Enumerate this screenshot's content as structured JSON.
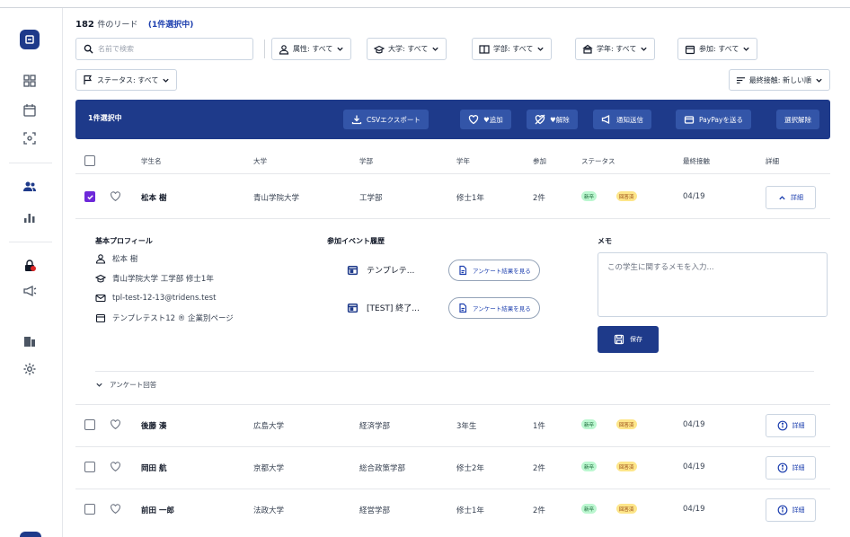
{
  "header": {
    "count": "182",
    "count_unit": "件のリード",
    "selected_note": "(1件選択中)"
  },
  "search": {
    "placeholder": "名前で検索"
  },
  "filters": [
    {
      "label": "属性: すべて",
      "icon": "user-icon"
    },
    {
      "label": "大学: すべて",
      "icon": "graduation-cap-icon"
    },
    {
      "label": "学部: すべて",
      "icon": "book-icon"
    },
    {
      "label": "学年: すべて",
      "icon": "person-group-icon"
    },
    {
      "label": "参加: すべて",
      "icon": "calendar-icon"
    },
    {
      "label": "ステータス: すべて",
      "icon": "flag-icon"
    }
  ],
  "sort": {
    "label": "最終接触: 新しい順"
  },
  "action_bar": {
    "selected_label": "1件選択中",
    "buttons": [
      {
        "label": "CSVエクスポート",
        "icon": "download-icon"
      },
      {
        "label": "♥追加",
        "icon": "heart-icon"
      },
      {
        "label": "♥解除",
        "icon": "heart-off-icon"
      },
      {
        "label": "通知送信",
        "icon": "megaphone-icon"
      },
      {
        "label": "PayPayを送る",
        "icon": "wallet-icon"
      },
      {
        "label": "選択解除",
        "icon": ""
      }
    ]
  },
  "columns": [
    "学生名",
    "大学",
    "学部",
    "学年",
    "参加",
    "ステータス",
    "最終接触",
    "詳細"
  ],
  "rows": [
    {
      "name": "松本 樹",
      "university": "青山学院大学",
      "faculty": "工学部",
      "year": "修士1年",
      "events": "2件",
      "status": [
        "新卒",
        "回答済"
      ],
      "last_contact": "04/19",
      "detail": "詳細",
      "selected": true
    },
    {
      "name": "後藤 湊",
      "university": "広島大学",
      "faculty": "経済学部",
      "year": "3年生",
      "events": "1件",
      "status": [
        "新卒",
        "回答済"
      ],
      "last_contact": "04/19",
      "detail": "詳細",
      "selected": false
    },
    {
      "name": "岡田 航",
      "university": "京都大学",
      "faculty": "総合政策学部",
      "year": "修士2年",
      "events": "2件",
      "status": [
        "新卒",
        "回答済"
      ],
      "last_contact": "04/19",
      "detail": "詳細",
      "selected": false
    },
    {
      "name": "前田 一郎",
      "university": "法政大学",
      "faculty": "経営学部",
      "year": "修士1年",
      "events": "2件",
      "status": [
        "新卒",
        "回答済"
      ],
      "last_contact": "04/19",
      "detail": "詳細",
      "selected": false
    }
  ],
  "expanded": {
    "profile_title": "基本プロフィール",
    "profile": {
      "name": "松本 樹",
      "school": "青山学院大学 工学部 修士1年",
      "email": "tpl-test-12-13@tridens.test",
      "page": "テンプレテスト12 ® 企業別ページ"
    },
    "events_title": "参加イベント履歴",
    "events": [
      {
        "name": "テンプレテ...",
        "button": "アンケート結果を見る"
      },
      {
        "name": "[TEST] 終了...",
        "button": "アンケート結果を見る"
      }
    ],
    "memo_title": "メモ",
    "memo_placeholder": "この学生に関するメモを入力...",
    "save_label": "保存",
    "survey_toggle": "アンケート回答"
  },
  "colors": {
    "primary": "#1e3a8a",
    "badge_green": "#bbf7d0",
    "badge_yellow": "#fde68a",
    "check": "#6d28d9"
  }
}
